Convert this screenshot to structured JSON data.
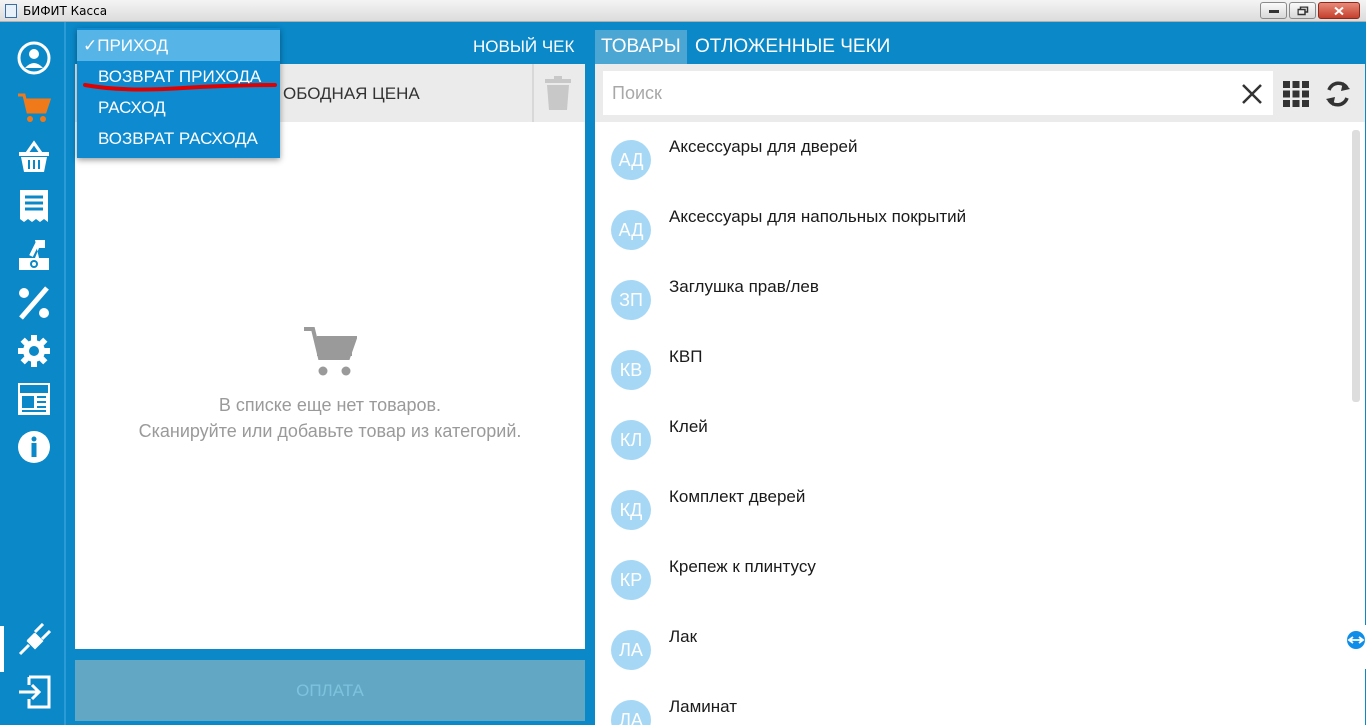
{
  "window": {
    "title": "БИФИТ Касса"
  },
  "left": {
    "new_check": "НОВЫЙ ЧЕК",
    "free_price": "ОБОДНАЯ ЦЕНА",
    "empty_line1": "В списке еще нет товаров.",
    "empty_line2": "Сканируйте или добавьте товар из категорий.",
    "pay": "ОПЛАТА"
  },
  "dropdown": {
    "options": [
      "✓ПРИХОД",
      "ВОЗВРАТ ПРИХОДА",
      "РАСХОД",
      "ВОЗВРАТ РАСХОДА"
    ],
    "selected_index": 0,
    "annotation_color": "#e00000"
  },
  "right": {
    "tabs": [
      "ТОВАРЫ",
      "ОТЛОЖЕННЫЕ ЧЕКИ"
    ],
    "search_placeholder": "Поиск",
    "items": [
      {
        "abbr": "АД",
        "label": "Аксессуары для дверей"
      },
      {
        "abbr": "АД",
        "label": "Аксессуары для напольных покрытий"
      },
      {
        "abbr": "ЗП",
        "label": "Заглушка прав/лев"
      },
      {
        "abbr": "КВ",
        "label": "КВП"
      },
      {
        "abbr": "КЛ",
        "label": "Клей"
      },
      {
        "abbr": "КД",
        "label": "Комплект дверей"
      },
      {
        "abbr": "КР",
        "label": "Крепеж к плинтусу"
      },
      {
        "abbr": "ЛА",
        "label": "Лак"
      },
      {
        "abbr": "ЛА",
        "label": "Ламинат"
      }
    ]
  },
  "sidebar_icons": [
    "user-icon",
    "cart-icon",
    "basket-icon",
    "receipt-icon",
    "cash-register-icon",
    "percent-icon",
    "gear-icon",
    "news-icon",
    "info-icon",
    "plug-icon",
    "logout-icon"
  ],
  "colors": {
    "primary": "#0a88c8",
    "active_icon": "#f07a1a",
    "avatar": "#a6d8f6"
  }
}
